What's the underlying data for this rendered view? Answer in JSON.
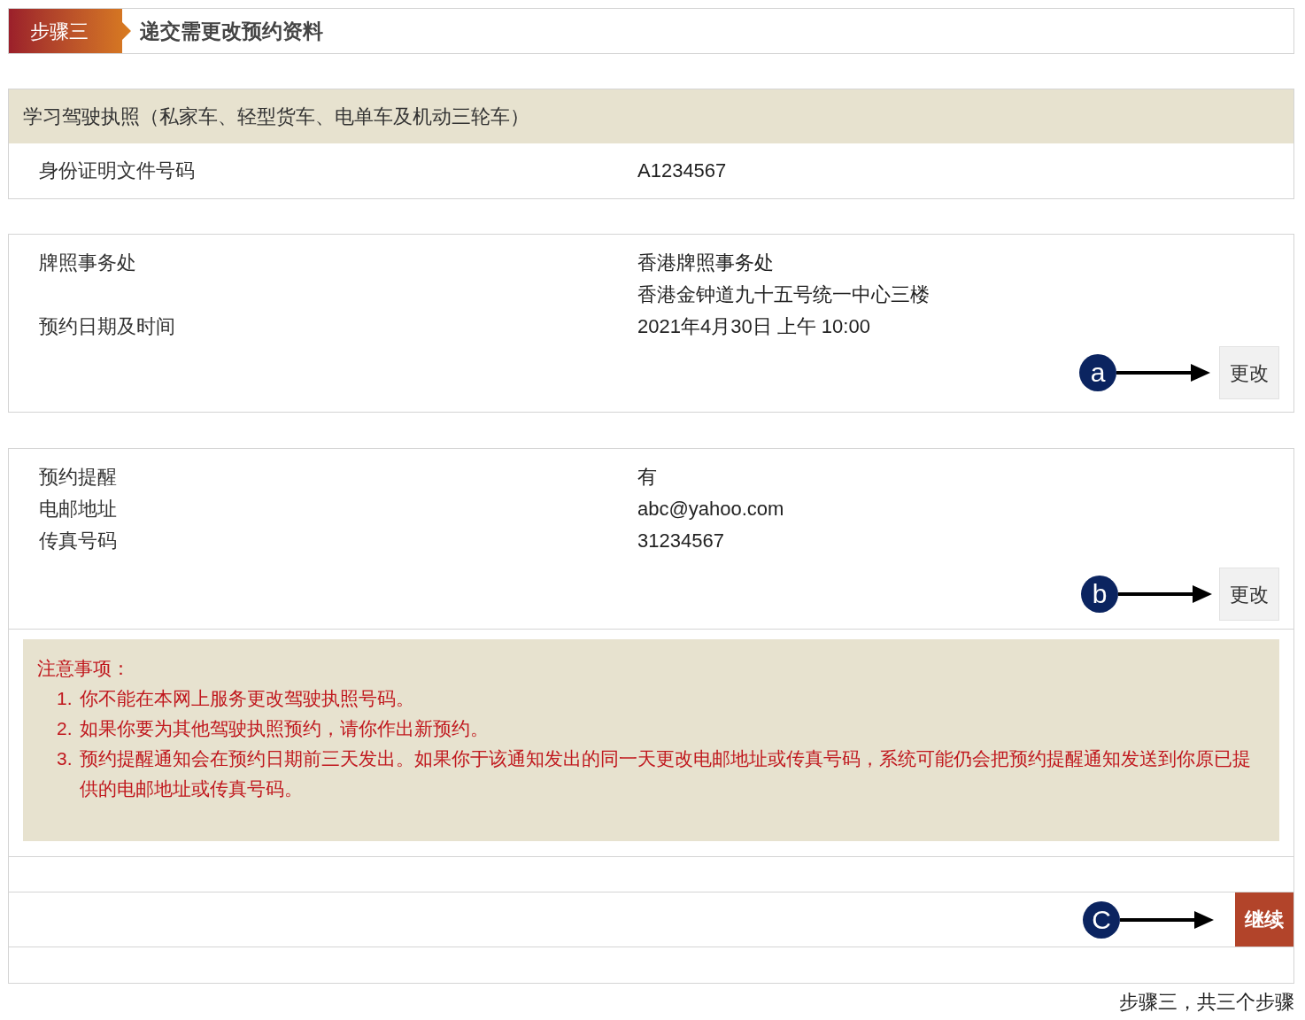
{
  "step": {
    "badge": "步骤三",
    "title": "递交需更改预约资料"
  },
  "license_section": {
    "heading": "学习驾驶执照（私家车、轻型货车、电单车及机动三轮车）",
    "rows": [
      {
        "label": "身份证明文件号码",
        "value_lines": [
          "A1234567"
        ]
      }
    ]
  },
  "appointment_section": {
    "rows": [
      {
        "label": "牌照事务处",
        "value_lines": [
          "香港牌照事务处",
          "香港金钟道九十五号统一中心三楼"
        ]
      },
      {
        "label": "预约日期及时间",
        "value_lines": [
          "2021年4月30日 上午 10:00"
        ]
      }
    ],
    "button": "更改",
    "callout": "a"
  },
  "reminder_section": {
    "rows": [
      {
        "label": "预约提醒",
        "value_lines": [
          "有"
        ]
      },
      {
        "label": "电邮地址",
        "value_lines": [
          "abc@yahoo.com"
        ]
      },
      {
        "label": "传真号码",
        "value_lines": [
          "31234567"
        ]
      }
    ],
    "button": "更改",
    "callout": "b"
  },
  "notice": {
    "title": "注意事项：",
    "items": [
      {
        "number": "1.",
        "text": "你不能在本网上服务更改驾驶执照号码。"
      },
      {
        "number": "2.",
        "text": "如果你要为其他驾驶执照预约，请你作出新预约。"
      },
      {
        "number": "3.",
        "text": "预约提醒通知会在预约日期前三天发出。如果你于该通知发出的同一天更改电邮地址或传真号码，系统可能仍会把预约提醒通知发送到你原已提供的电邮地址或传真号码。"
      }
    ]
  },
  "continue": {
    "button": "继续",
    "callout": "C"
  },
  "footer": "步骤三，共三个步骤"
}
